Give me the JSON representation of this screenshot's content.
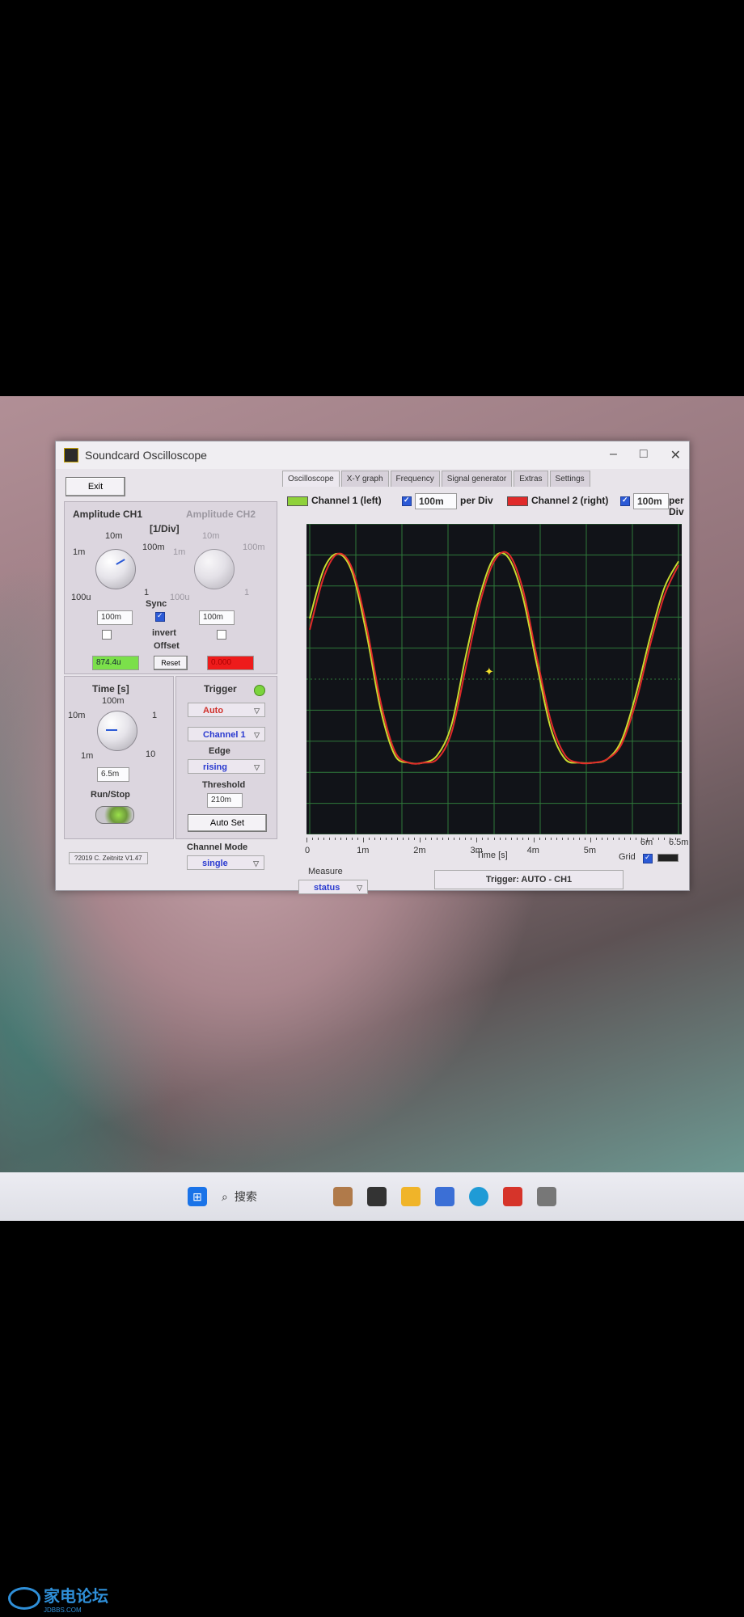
{
  "window": {
    "title": "Soundcard Oscilloscope",
    "minimize": "–",
    "maximize": "□",
    "close": "✕"
  },
  "exit_label": "Exit",
  "amplitude": {
    "ch1_title": "Amplitude CH1",
    "ch2_title": "Amplitude CH2",
    "unit": "[1/Div]",
    "ch1_scale": {
      "top": "10m",
      "right_top": "100m",
      "left_top": "1m",
      "left_bottom": "100u",
      "right_bottom": "1"
    },
    "ch2_scale": {
      "top": "10m",
      "right_top": "100m",
      "left_top": "1m",
      "left_bottom": "100u",
      "right_bottom": "1"
    },
    "ch1_value": "100m",
    "ch2_value": "100m",
    "sync_label": "Sync",
    "invert_label": "invert",
    "offset_label": "Offset",
    "ch1_offset": "874.4u",
    "ch2_offset": "0.000",
    "reset_label": "Reset"
  },
  "time": {
    "title": "Time [s]",
    "scale": {
      "top": "100m",
      "left_top": "10m",
      "right_top": "1",
      "left_bottom": "1m",
      "right_bottom": "10"
    },
    "value": "6.5m",
    "run_stop_label": "Run/Stop"
  },
  "trigger": {
    "title": "Trigger",
    "mode": "Auto",
    "source": "Channel 1",
    "edge_label": "Edge",
    "edge": "rising",
    "threshold_label": "Threshold",
    "threshold": "210m",
    "auto_set_label": "Auto Set"
  },
  "channel_mode": {
    "label": "Channel Mode",
    "value": "single"
  },
  "copyright": "?2019  C. Zeitnitz V1.47",
  "tabs": [
    "Oscilloscope",
    "X-Y graph",
    "Frequency",
    "Signal generator",
    "Extras",
    "Settings"
  ],
  "channels": {
    "ch1_label": "Channel 1 (left)",
    "ch1_per_div": "100m",
    "ch2_label": "Channel 2 (right)",
    "ch2_per_div": "100m",
    "per_div": "per Div",
    "ch1_color": "#8fd13a",
    "ch2_color": "#e02a2a"
  },
  "measure": {
    "label": "Measure",
    "value": "status"
  },
  "trigger_status": "Trigger: AUTO - CH1",
  "grid_label": "Grid",
  "taskbar": {
    "search": "搜索"
  },
  "watermark": {
    "brand": "家电论坛",
    "site": "JDBBS.COM"
  },
  "chart_data": {
    "type": "line",
    "xlabel": "Time [s]",
    "x_ticks": [
      "0",
      "1m",
      "2m",
      "3m",
      "4m",
      "5m",
      "6m",
      "6.5m"
    ],
    "xlim": [
      0,
      0.0065
    ],
    "ylim": [
      -0.4,
      0.4
    ],
    "grid": true,
    "series": [
      {
        "name": "Channel 1 (left)",
        "color": "#c9d930",
        "x": [
          0,
          0.00025,
          0.0005,
          0.00075,
          0.001,
          0.00125,
          0.0015,
          0.00175,
          0.002,
          0.00225,
          0.0025,
          0.00275,
          0.003,
          0.00325,
          0.0035,
          0.00375,
          0.004,
          0.00425,
          0.0045,
          0.00475,
          0.005,
          0.00525,
          0.0055,
          0.00575,
          0.006,
          0.00625,
          0.0065
        ],
        "y": [
          0.16,
          0.29,
          0.33,
          0.28,
          0.12,
          -0.08,
          -0.2,
          -0.22,
          -0.22,
          -0.2,
          -0.12,
          0.06,
          0.22,
          0.32,
          0.32,
          0.22,
          0.04,
          -0.13,
          -0.21,
          -0.22,
          -0.22,
          -0.21,
          -0.16,
          -0.04,
          0.11,
          0.24,
          0.31
        ]
      },
      {
        "name": "Channel 2 (right)",
        "color": "#e02a2a",
        "x": [
          0,
          0.00025,
          0.0005,
          0.00075,
          0.001,
          0.00125,
          0.0015,
          0.00175,
          0.002,
          0.00225,
          0.0025,
          0.00275,
          0.003,
          0.00325,
          0.0035,
          0.00375,
          0.004,
          0.00425,
          0.0045,
          0.00475,
          0.005,
          0.00525,
          0.0055,
          0.00575,
          0.006,
          0.00625,
          0.0065
        ],
        "y": [
          0.13,
          0.27,
          0.33,
          0.29,
          0.14,
          -0.06,
          -0.19,
          -0.22,
          -0.22,
          -0.21,
          -0.14,
          0.03,
          0.2,
          0.31,
          0.33,
          0.24,
          0.06,
          -0.11,
          -0.2,
          -0.22,
          -0.22,
          -0.21,
          -0.17,
          -0.06,
          0.09,
          0.22,
          0.3
        ]
      }
    ]
  }
}
